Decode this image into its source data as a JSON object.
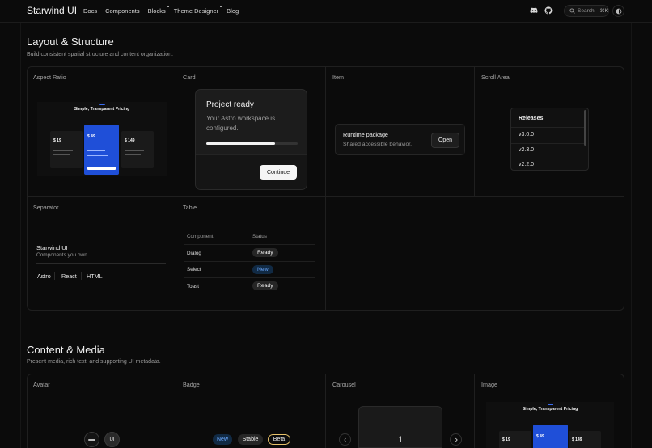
{
  "header": {
    "brand": "Starwind UI",
    "nav": [
      "Docs",
      "Components",
      "Blocks",
      "Theme Designer",
      "Blog"
    ],
    "search_label": "Search",
    "search_shortcut": "⌘K"
  },
  "layout_section": {
    "title": "Layout & Structure",
    "description": "Build consistent spatial structure and content organization.",
    "cells": {
      "aspect_ratio": "Aspect Ratio",
      "card": "Card",
      "item": "Item",
      "scroll_area": "Scroll Area",
      "separator": "Separator",
      "table": "Table"
    }
  },
  "aspect_demo": {
    "title": "Simple, Transparent Pricing",
    "prices": [
      "$ 19",
      "$ 49",
      "$ 149"
    ]
  },
  "card_demo": {
    "title": "Project ready",
    "body": "Your Astro workspace is configured.",
    "progress": 0.75,
    "button": "Continue"
  },
  "item_demo": {
    "title": "Runtime package",
    "description": "Shared accessible behavior.",
    "button": "Open"
  },
  "scroll_demo": {
    "heading": "Releases",
    "items": [
      "v3.0.0",
      "v2.3.0",
      "v2.2.0"
    ]
  },
  "separator_demo": {
    "title": "Starwind UI",
    "description": "Components you own.",
    "links": [
      "Astro",
      "React",
      "HTML"
    ]
  },
  "table_demo": {
    "headers": [
      "Component",
      "Status"
    ],
    "rows": [
      {
        "component": "Dialog",
        "status": "Ready"
      },
      {
        "component": "Select",
        "status": "New"
      },
      {
        "component": "Toast",
        "status": "Ready"
      }
    ]
  },
  "content_section": {
    "title": "Content & Media",
    "description": "Present media, rich text, and supporting UI metadata.",
    "cells": {
      "avatar": "Avatar",
      "badge": "Badge",
      "carousel": "Carousel",
      "image": "Image"
    }
  },
  "avatar_demo": {
    "fallback": "UI"
  },
  "badge_demo": {
    "badges": [
      "New",
      "Stable",
      "Beta"
    ]
  },
  "carousel_demo": {
    "slide": "1"
  },
  "colors": {
    "background": "#0b0b0b",
    "accent_blue": "#1f4fd8",
    "badge_beta": "#e8c26a"
  }
}
